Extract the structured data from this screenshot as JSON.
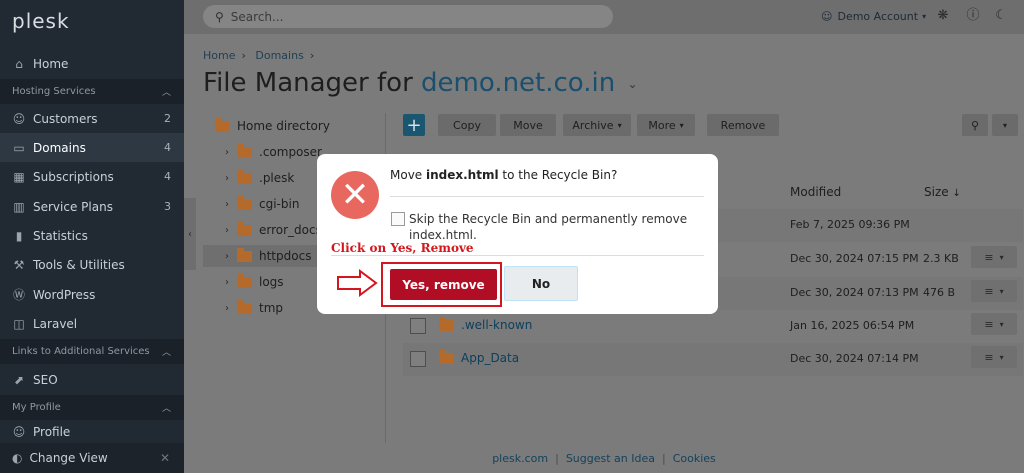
{
  "sidebar": {
    "logo": "plesk",
    "items": [
      {
        "label": "Home",
        "icon": "home-icon"
      },
      {
        "label": "Customers",
        "count": "2",
        "icon": "user-icon"
      },
      {
        "label": "Domains",
        "count": "4",
        "icon": "monitor-icon"
      },
      {
        "label": "Subscriptions",
        "count": "4",
        "icon": "grid-icon"
      },
      {
        "label": "Service Plans",
        "count": "3",
        "icon": "book-icon"
      },
      {
        "label": "Statistics",
        "icon": "chart-icon"
      },
      {
        "label": "Tools & Utilities",
        "icon": "tools-icon"
      },
      {
        "label": "WordPress",
        "icon": "wordpress-icon"
      },
      {
        "label": "Laravel",
        "icon": "laravel-icon"
      },
      {
        "label": "SEO",
        "icon": "seo-icon"
      },
      {
        "label": "Profile",
        "icon": "profile-icon"
      }
    ],
    "sections": {
      "hosting": "Hosting Services",
      "links": "Links to Additional Services",
      "profile": "My Profile"
    },
    "change_view": "Change View"
  },
  "topbar": {
    "search_placeholder": "Search...",
    "account": "Demo Account"
  },
  "breadcrumb": [
    "Home",
    "Domains"
  ],
  "title": {
    "prefix": "File Manager for",
    "domain": "demo.net.co.in"
  },
  "tree": {
    "root": "Home directory",
    "folders": [
      ".composer",
      ".plesk",
      "cgi-bin",
      "error_docs",
      "httpdocs",
      "logs",
      "tmp"
    ]
  },
  "toolbar": {
    "copy": "Copy",
    "move": "Move",
    "archive": "Archive",
    "more": "More",
    "remove": "Remove"
  },
  "table": {
    "col_modified": "Modified",
    "col_size": "Size",
    "rows": [
      {
        "name": "",
        "modified": "Feb 7, 2025 09:36 PM",
        "size": ""
      },
      {
        "name": "",
        "modified": "Dec 30, 2024 07:15 PM",
        "size": "2.3 KB"
      },
      {
        "name": "",
        "modified": "Dec 30, 2024 07:13 PM",
        "size": "476 B"
      },
      {
        "name": ".well-known",
        "modified": "Jan 16, 2025 06:54 PM",
        "size": ""
      },
      {
        "name": "App_Data",
        "modified": "Dec 30, 2024 07:14 PM",
        "size": ""
      }
    ]
  },
  "dialog": {
    "msg_prefix": "Move ",
    "msg_file": "index.html",
    "msg_suffix": " to the Recycle Bin?",
    "skip_text": "Skip the Recycle Bin and permanently remove",
    "skip_file": "index.html",
    "yes": "Yes, remove",
    "no": "No"
  },
  "annotation": {
    "label": "Click on Yes, Remove",
    "color": "#d4161e"
  },
  "footer": {
    "links": [
      "plesk.com",
      "Suggest an Idea",
      "Cookies"
    ]
  }
}
